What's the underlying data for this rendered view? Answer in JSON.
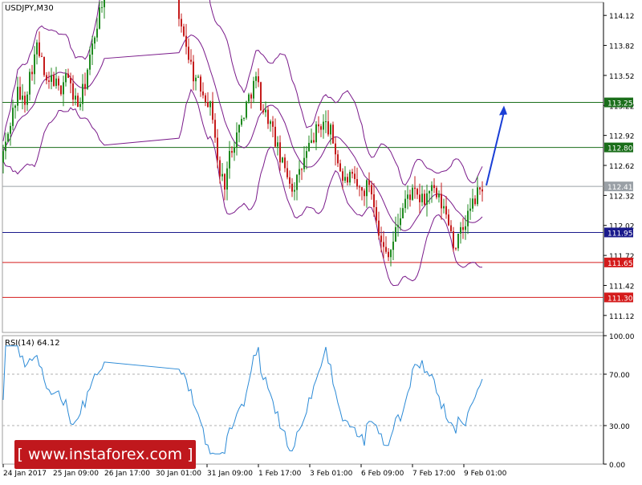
{
  "chart_data": [
    {
      "type": "candlestick",
      "symbol_label": "USDJPY,M30",
      "ylim": [
        110.95,
        114.25
      ],
      "y_ticks": [
        "114.12",
        "113.82",
        "113.52",
        "113.22",
        "112.92",
        "112.62",
        "112.32",
        "112.02",
        "111.72",
        "111.42",
        "111.12"
      ],
      "x_ticks": [
        "24 Jan 2017",
        "25 Jan 09:00",
        "26 Jan 17:00",
        "30 Jan 01:00",
        "31 Jan 09:00",
        "1 Feb 17:00",
        "3 Feb 01:00",
        "6 Feb 09:00",
        "7 Feb 17:00",
        "9 Feb 01:00"
      ],
      "price_path": [
        [
          0,
          112.65
        ],
        [
          8,
          112.85
        ],
        [
          14,
          113.1
        ],
        [
          22,
          113.35
        ],
        [
          30,
          113.25
        ],
        [
          38,
          113.55
        ],
        [
          46,
          113.8
        ],
        [
          52,
          113.65
        ],
        [
          58,
          113.4
        ],
        [
          66,
          113.5
        ],
        [
          74,
          113.35
        ],
        [
          82,
          113.55
        ],
        [
          90,
          113.35
        ],
        [
          98,
          113.2
        ],
        [
          106,
          113.45
        ],
        [
          114,
          113.75
        ],
        [
          122,
          114.1
        ],
        [
          128,
          114.3
        ],
        [
          228,
          114.0
        ],
        [
          234,
          113.75
        ],
        [
          242,
          113.5
        ],
        [
          250,
          113.4
        ],
        [
          258,
          113.3
        ],
        [
          266,
          113.1
        ],
        [
          272,
          112.55
        ],
        [
          280,
          112.45
        ],
        [
          288,
          112.8
        ],
        [
          296,
          112.95
        ],
        [
          304,
          113.15
        ],
        [
          312,
          113.35
        ],
        [
          320,
          113.5
        ],
        [
          326,
          113.2
        ],
        [
          334,
          113.1
        ],
        [
          342,
          112.9
        ],
        [
          350,
          112.65
        ],
        [
          358,
          112.55
        ],
        [
          364,
          112.4
        ],
        [
          372,
          112.5
        ],
        [
          380,
          112.7
        ],
        [
          388,
          112.85
        ],
        [
          396,
          113.0
        ],
        [
          404,
          113.05
        ],
        [
          412,
          112.95
        ],
        [
          420,
          112.7
        ],
        [
          428,
          112.45
        ],
        [
          436,
          112.5
        ],
        [
          444,
          112.4
        ],
        [
          452,
          112.35
        ],
        [
          460,
          112.45
        ],
        [
          468,
          112.2
        ],
        [
          474,
          111.85
        ],
        [
          480,
          111.75
        ],
        [
          488,
          111.8
        ],
        [
          496,
          112.05
        ],
        [
          504,
          112.25
        ],
        [
          512,
          112.35
        ],
        [
          520,
          112.3
        ],
        [
          528,
          112.25
        ],
        [
          536,
          112.4
        ],
        [
          544,
          112.3
        ],
        [
          552,
          112.2
        ],
        [
          560,
          112.05
        ],
        [
          566,
          111.8
        ],
        [
          572,
          111.9
        ],
        [
          578,
          112.0
        ],
        [
          584,
          112.15
        ],
        [
          590,
          112.25
        ],
        [
          596,
          112.35
        ],
        [
          602,
          112.42
        ]
      ],
      "level_lines": [
        {
          "value": 113.25,
          "label": "113.25",
          "color": "#1a6e1a"
        },
        {
          "value": 112.8,
          "label": "112.80",
          "color": "#1a6e1a"
        },
        {
          "value": 112.41,
          "label": "112.41",
          "color": "#9aa0a6"
        },
        {
          "value": 111.95,
          "label": "111.95",
          "color": "#1a1a8c"
        },
        {
          "value": 111.65,
          "label": "111.65",
          "color": "#d41b1b"
        },
        {
          "value": 111.3,
          "label": "111.30",
          "color": "#d41b1b"
        }
      ],
      "target_arrow": {
        "from": [
          112.42
        ],
        "to": [
          113.25
        ],
        "color": "#1a3fd6"
      },
      "colors": {
        "bull": "#1f8a1f",
        "bear": "#c51b1b",
        "bands": "#7a1a8a"
      }
    },
    {
      "type": "line",
      "indicator_label": "RSI(14) 64.12",
      "ylim": [
        0,
        100
      ],
      "y_ticks": [
        "100.00",
        "70.00",
        "30.00",
        "0.00"
      ],
      "levels": [
        70,
        30
      ],
      "series_color": "#2b8ad6"
    }
  ],
  "watermark": {
    "text": "[  www.instaforex.com ]",
    "color": "#c0181d"
  }
}
